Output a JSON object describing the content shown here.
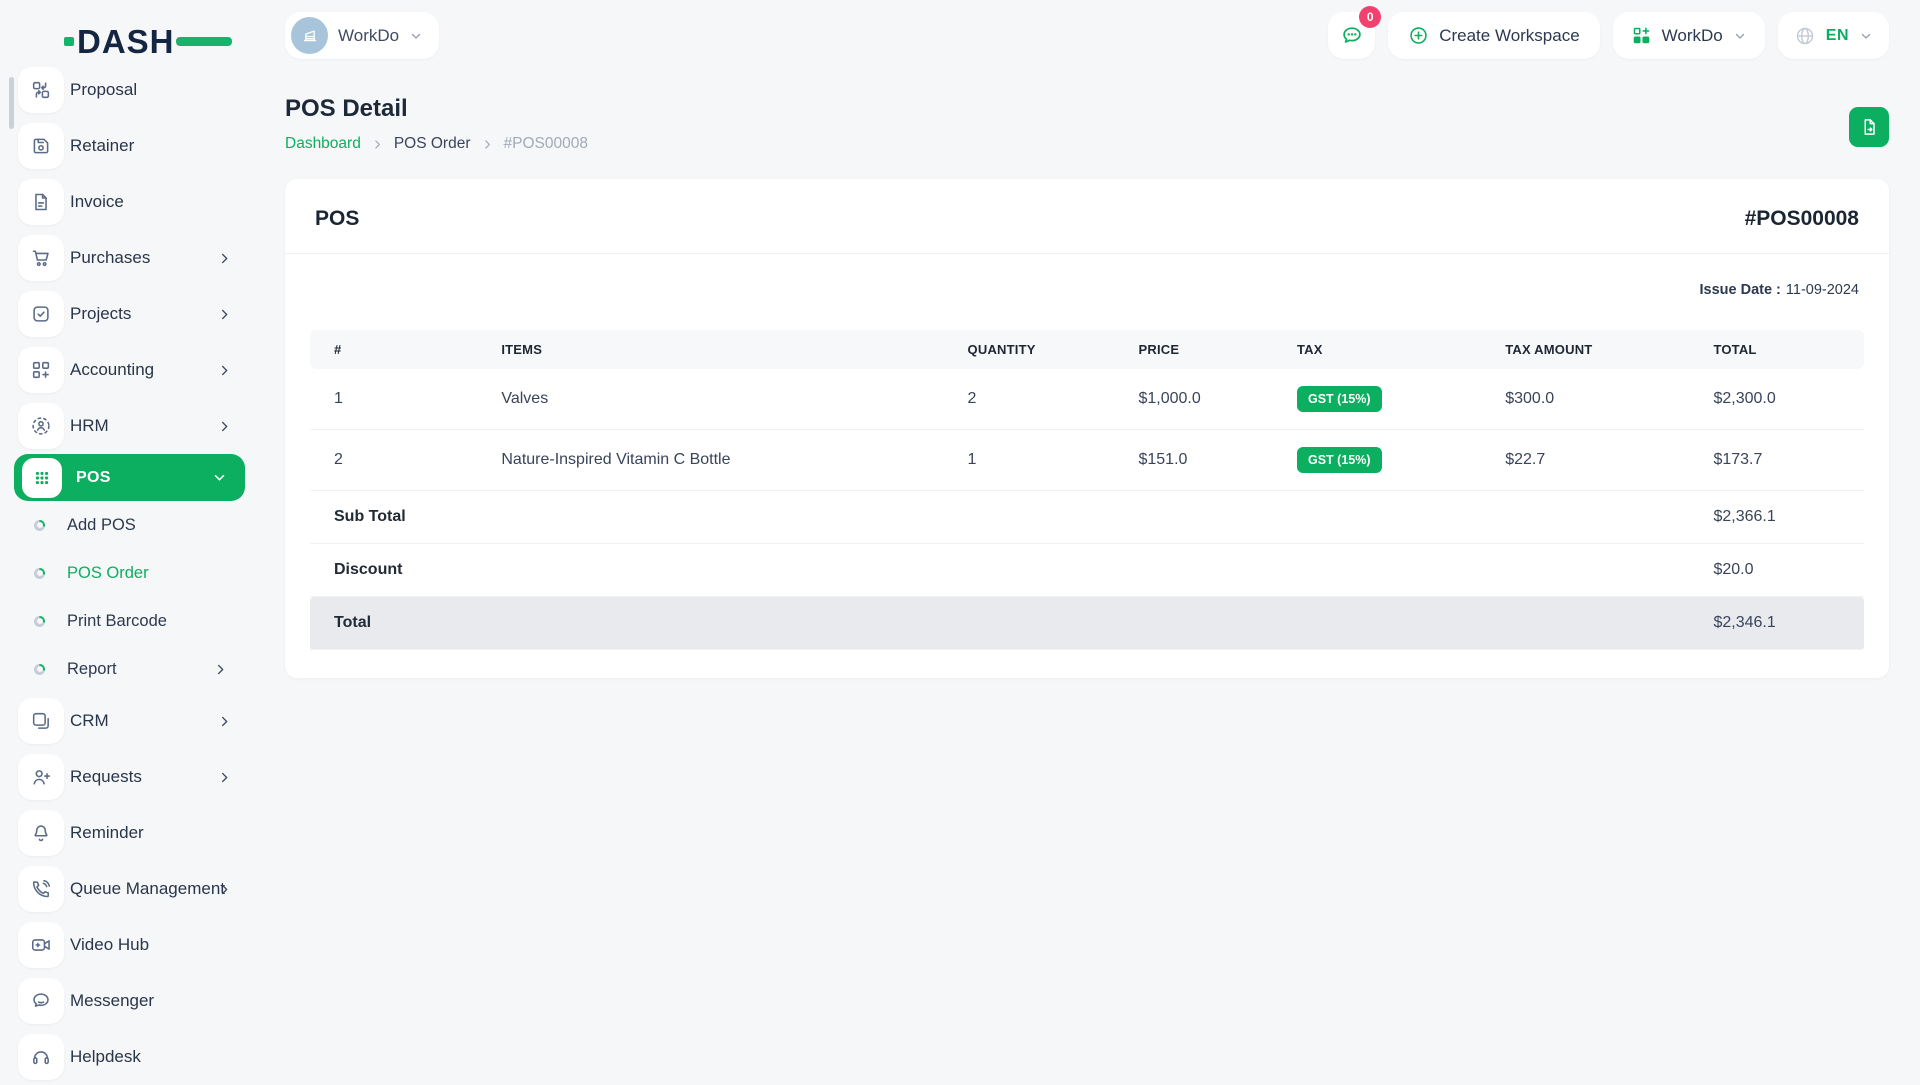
{
  "logo": {
    "text": "DASH"
  },
  "header": {
    "workspace": {
      "label": "WorkDo"
    },
    "chat_badge": "0",
    "create_workspace_label": "Create Workspace",
    "app_menu_label": "WorkDo",
    "language": "EN"
  },
  "sidebar": {
    "items": [
      {
        "label": "Proposal"
      },
      {
        "label": "Retainer"
      },
      {
        "label": "Invoice"
      },
      {
        "label": "Purchases"
      },
      {
        "label": "Projects"
      },
      {
        "label": "Accounting"
      },
      {
        "label": "HRM"
      },
      {
        "label": "POS"
      }
    ],
    "pos_submenu": [
      {
        "label": "Add POS"
      },
      {
        "label": "POS Order"
      },
      {
        "label": "Print Barcode"
      },
      {
        "label": "Report"
      }
    ],
    "items_after": [
      {
        "label": "CRM"
      },
      {
        "label": "Requests"
      },
      {
        "label": "Reminder"
      },
      {
        "label": "Queue Management"
      },
      {
        "label": "Video Hub"
      },
      {
        "label": "Messenger"
      },
      {
        "label": "Helpdesk"
      }
    ]
  },
  "page": {
    "title": "POS Detail",
    "breadcrumb": [
      "Dashboard",
      "POS Order",
      "#POS00008"
    ]
  },
  "card": {
    "title": "POS",
    "number": "#POS00008",
    "issue_date_label": "Issue Date :",
    "issue_date": "11-09-2024",
    "table": {
      "columns": [
        "#",
        "ITEMS",
        "QUANTITY",
        "PRICE",
        "TAX",
        "TAX AMOUNT",
        "TOTAL"
      ],
      "rows": [
        {
          "no": "1",
          "item": "Valves",
          "qty": "2",
          "price": "$1,000.0",
          "tax": "GST (15%)",
          "tax_amount": "$300.0",
          "total": "$2,300.0"
        },
        {
          "no": "2",
          "item": "Nature-Inspired Vitamin C Bottle",
          "qty": "1",
          "price": "$151.0",
          "tax": "GST (15%)",
          "tax_amount": "$22.7",
          "total": "$173.7"
        }
      ],
      "summary": [
        {
          "label": "Sub Total",
          "value": "$2,366.1"
        },
        {
          "label": "Discount",
          "value": "$20.0"
        },
        {
          "label": "Total",
          "value": "$2,346.1"
        }
      ]
    }
  }
}
